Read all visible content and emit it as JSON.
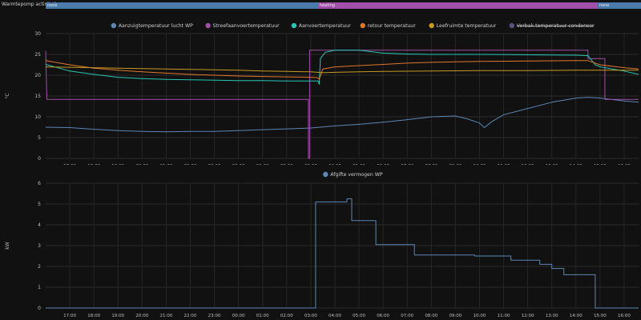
{
  "timeline": {
    "label": "Warmtepomp activiteit",
    "segments": [
      {
        "name": "none",
        "start": 16.0,
        "end": 3.3,
        "color": "#4a7bab"
      },
      {
        "name": "heating",
        "start": 3.3,
        "end": 14.9,
        "color": "#a050a8"
      },
      {
        "name": "none",
        "start": 14.9,
        "end": 16.6,
        "color": "#4a7bab"
      }
    ]
  },
  "x_axis": {
    "start_hour": 16.0,
    "end_hour": 16.6,
    "tick_labels": [
      "17:00",
      "18:00",
      "19:00",
      "20:00",
      "21:00",
      "22:00",
      "23:00",
      "00:00",
      "01:00",
      "02:00",
      "03:00",
      "04:00",
      "05:00",
      "06:00",
      "07:00",
      "08:00",
      "09:00",
      "10:00",
      "11:00",
      "12:00",
      "13:00",
      "14:00",
      "15:00",
      "16:00"
    ]
  },
  "chart_data": [
    {
      "type": "line",
      "ylabel": "°C",
      "ylim": [
        0,
        30
      ],
      "yticks": [
        "0",
        "5",
        "10",
        "15",
        "20",
        "25",
        "30"
      ],
      "grid": true,
      "legend_position": "top",
      "series": [
        {
          "name": "Aanzuigtemperatuur lucht WP",
          "color": "#5b86b5",
          "style": "smooth",
          "points": [
            [
              16.0,
              7.5
            ],
            [
              17.0,
              7.4
            ],
            [
              18.0,
              7.0
            ],
            [
              19.0,
              6.7
            ],
            [
              20.0,
              6.5
            ],
            [
              21.0,
              6.4
            ],
            [
              22.0,
              6.5
            ],
            [
              23.0,
              6.5
            ],
            [
              0.0,
              6.7
            ],
            [
              1.0,
              6.9
            ],
            [
              2.0,
              7.1
            ],
            [
              3.0,
              7.3
            ],
            [
              4.0,
              7.8
            ],
            [
              5.0,
              8.2
            ],
            [
              6.0,
              8.7
            ],
            [
              7.0,
              9.3
            ],
            [
              8.0,
              10.0
            ],
            [
              9.0,
              10.2
            ],
            [
              9.5,
              9.5
            ],
            [
              10.0,
              8.5
            ],
            [
              10.2,
              7.4
            ],
            [
              10.5,
              8.8
            ],
            [
              11.0,
              10.5
            ],
            [
              12.0,
              12.0
            ],
            [
              13.0,
              13.5
            ],
            [
              14.0,
              14.5
            ],
            [
              14.5,
              14.7
            ],
            [
              15.0,
              14.5
            ],
            [
              16.0,
              13.8
            ],
            [
              16.6,
              13.5
            ]
          ]
        },
        {
          "name": "Streefaanvoertemperatuur",
          "color": "#a050a8",
          "style": "step",
          "points": [
            [
              16.0,
              25.8
            ],
            [
              16.05,
              14.2
            ],
            [
              2.9,
              14.2
            ],
            [
              2.9,
              0.0
            ],
            [
              2.95,
              0.0
            ],
            [
              2.95,
              26.0
            ],
            [
              3.0,
              26.0
            ],
            [
              14.5,
              26.0
            ],
            [
              14.5,
              24.0
            ],
            [
              15.2,
              24.0
            ],
            [
              15.2,
              14.2
            ],
            [
              16.6,
              14.2
            ]
          ]
        },
        {
          "name": "Aanvoertemperatuur",
          "color": "#26c6b5",
          "style": "smooth",
          "points": [
            [
              16.0,
              22.6
            ],
            [
              17.0,
              21.0
            ],
            [
              18.0,
              20.2
            ],
            [
              19.0,
              19.5
            ],
            [
              20.0,
              19.2
            ],
            [
              21.0,
              19.0
            ],
            [
              22.0,
              18.9
            ],
            [
              23.0,
              18.8
            ],
            [
              0.0,
              18.7
            ],
            [
              1.0,
              18.7
            ],
            [
              2.0,
              18.6
            ],
            [
              3.0,
              18.6
            ],
            [
              3.3,
              18.6
            ],
            [
              3.35,
              17.8
            ],
            [
              3.4,
              24.0
            ],
            [
              3.6,
              25.5
            ],
            [
              4.0,
              26.0
            ],
            [
              5.0,
              26.0
            ],
            [
              6.0,
              25.3
            ],
            [
              7.0,
              25.1
            ],
            [
              8.0,
              25.0
            ],
            [
              10.0,
              25.0
            ],
            [
              12.0,
              24.9
            ],
            [
              14.0,
              24.8
            ],
            [
              14.5,
              24.7
            ],
            [
              14.8,
              22.5
            ],
            [
              15.0,
              22.0
            ],
            [
              16.0,
              21.0
            ],
            [
              16.6,
              20.2
            ]
          ]
        },
        {
          "name": "retour temperatuur",
          "color": "#e0782a",
          "style": "smooth",
          "points": [
            [
              16.0,
              23.5
            ],
            [
              17.0,
              22.5
            ],
            [
              18.0,
              21.7
            ],
            [
              19.0,
              21.2
            ],
            [
              20.0,
              20.8
            ],
            [
              21.0,
              20.5
            ],
            [
              22.0,
              20.2
            ],
            [
              23.0,
              20.0
            ],
            [
              0.0,
              19.8
            ],
            [
              1.0,
              19.7
            ],
            [
              2.0,
              19.6
            ],
            [
              3.0,
              19.5
            ],
            [
              3.3,
              19.4
            ],
            [
              3.35,
              19.0
            ],
            [
              3.5,
              21.5
            ],
            [
              4.0,
              22.0
            ],
            [
              5.0,
              22.3
            ],
            [
              6.0,
              22.6
            ],
            [
              7.0,
              22.9
            ],
            [
              8.0,
              23.1
            ],
            [
              10.0,
              23.3
            ],
            [
              12.0,
              23.4
            ],
            [
              14.0,
              23.5
            ],
            [
              14.5,
              23.5
            ],
            [
              15.0,
              22.5
            ],
            [
              16.0,
              21.8
            ],
            [
              16.6,
              21.5
            ]
          ]
        },
        {
          "name": "Leefruimte temperatuur",
          "color": "#c79a22",
          "style": "smooth",
          "points": [
            [
              16.0,
              22.0
            ],
            [
              17.0,
              21.9
            ],
            [
              18.0,
              21.8
            ],
            [
              19.0,
              21.7
            ],
            [
              20.0,
              21.6
            ],
            [
              21.0,
              21.5
            ],
            [
              22.0,
              21.4
            ],
            [
              23.0,
              21.3
            ],
            [
              0.0,
              21.2
            ],
            [
              1.0,
              21.0
            ],
            [
              2.0,
              20.9
            ],
            [
              3.0,
              20.8
            ],
            [
              3.5,
              20.6
            ],
            [
              4.0,
              20.7
            ],
            [
              5.0,
              20.8
            ],
            [
              6.0,
              20.9
            ],
            [
              8.0,
              21.0
            ],
            [
              10.0,
              21.1
            ],
            [
              12.0,
              21.1
            ],
            [
              14.0,
              21.2
            ],
            [
              15.0,
              21.2
            ],
            [
              16.0,
              21.2
            ],
            [
              16.6,
              21.2
            ]
          ]
        },
        {
          "name": "Verbak.temperatuur condensor",
          "color": "#8f7bd0",
          "style": "hidden",
          "strikethrough": true,
          "points": []
        }
      ]
    },
    {
      "type": "line",
      "ylabel": "kW",
      "ylim": [
        0,
        6
      ],
      "yticks": [
        "0",
        "1",
        "2",
        "3",
        "4",
        "5",
        "6"
      ],
      "grid": true,
      "legend_position": "top",
      "series": [
        {
          "name": "Afgifte vermogen WP",
          "color": "#5b86b5",
          "style": "step",
          "points": [
            [
              16.0,
              0.0
            ],
            [
              3.2,
              0.0
            ],
            [
              3.2,
              5.1
            ],
            [
              4.5,
              5.1
            ],
            [
              4.5,
              5.25
            ],
            [
              4.7,
              5.25
            ],
            [
              4.7,
              4.2
            ],
            [
              5.7,
              4.2
            ],
            [
              5.7,
              3.05
            ],
            [
              7.3,
              3.05
            ],
            [
              7.3,
              2.55
            ],
            [
              9.8,
              2.55
            ],
            [
              9.8,
              2.5
            ],
            [
              11.3,
              2.5
            ],
            [
              11.3,
              2.3
            ],
            [
              12.5,
              2.3
            ],
            [
              12.5,
              2.1
            ],
            [
              13.0,
              2.1
            ],
            [
              13.0,
              1.9
            ],
            [
              13.5,
              1.9
            ],
            [
              13.5,
              1.6
            ],
            [
              14.8,
              1.6
            ],
            [
              14.8,
              0.0
            ],
            [
              16.6,
              0.0
            ]
          ]
        }
      ]
    }
  ]
}
